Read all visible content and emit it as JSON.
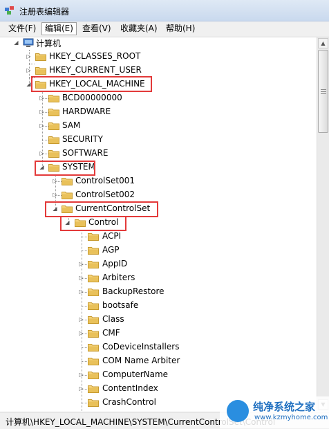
{
  "window": {
    "title": "注册表编辑器"
  },
  "menu": [
    {
      "label": "文件(F)"
    },
    {
      "label": "编辑(E)"
    },
    {
      "label": "查看(V)"
    },
    {
      "label": "收藏夹(A)"
    },
    {
      "label": "帮助(H)"
    }
  ],
  "tree": {
    "root": "计算机",
    "hives": [
      "HKEY_CLASSES_ROOT",
      "HKEY_CURRENT_USER",
      "HKEY_LOCAL_MACHINE"
    ],
    "hklm_children": [
      "BCD00000000",
      "HARDWARE",
      "SAM",
      "SECURITY",
      "SOFTWARE",
      "SYSTEM"
    ],
    "system_children": [
      "ControlSet001",
      "ControlSet002",
      "CurrentControlSet"
    ],
    "ccs_children": [
      "Control"
    ],
    "control_children": [
      "ACPI",
      "AGP",
      "AppID",
      "Arbiters",
      "BackupRestore",
      "bootsafe",
      "Class",
      "CMF",
      "CoDeviceInstallers",
      "COM Name Arbiter",
      "ComputerName",
      "ContentIndex",
      "CrashControl"
    ]
  },
  "status": {
    "path": "计算机\\HKEY_LOCAL_MACHINE\\SYSTEM\\CurrentControlSet\\Control"
  },
  "watermark": {
    "name": "纯净系统之家",
    "url": "www.kzmyhome.com"
  },
  "colors": {
    "highlight": "#e33a3a",
    "folder": "#e9c15a",
    "watermark": "#1f6fc0"
  }
}
